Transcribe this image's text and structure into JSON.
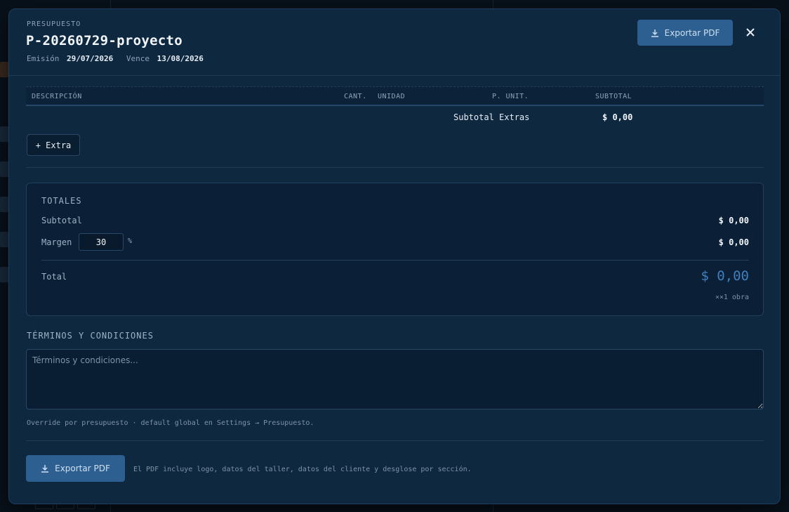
{
  "header": {
    "eyebrow": "PRESUPUESTO",
    "title": "P-20260729-proyecto",
    "emission_label": "Emisión",
    "emission_date": "29/07/2026",
    "due_label": "Vence",
    "due_date": "13/08/2026",
    "export_label": "Exportar PDF"
  },
  "extras_table": {
    "columns": [
      "DESCRIPCIÓN",
      "CANT.",
      "UNIDAD",
      "P. UNIT.",
      "SUBTOTAL"
    ],
    "subtotal_label": "Subtotal Extras",
    "subtotal_value": "$ 0,00",
    "add_extra_label": "+ Extra"
  },
  "totals": {
    "title": "TOTALES",
    "subtotal_label": "Subtotal",
    "subtotal_value": "$ 0,00",
    "margin_label": "Margen",
    "margin_value": "30",
    "margin_unit": "%",
    "margin_amount": "$ 0,00",
    "total_label": "Total",
    "total_value": "$ 0,00",
    "total_note": "××1 obra"
  },
  "terms": {
    "title": "TÉRMINOS Y CONDICIONES",
    "placeholder": "Términos y condiciones...",
    "value": "",
    "note": "Override por presupuesto · default global en Settings → Presupuesto."
  },
  "footer": {
    "export_label": "Exportar PDF",
    "note": "El PDF incluye logo, datos del taller, datos del cliente y desglose por sección."
  },
  "colors": {
    "modal_bg": "#0e2840",
    "primary_button": "#2d5f91",
    "total_accent": "#3f7fbf"
  },
  "icons": {
    "export": "download-icon",
    "close": "close-icon"
  }
}
